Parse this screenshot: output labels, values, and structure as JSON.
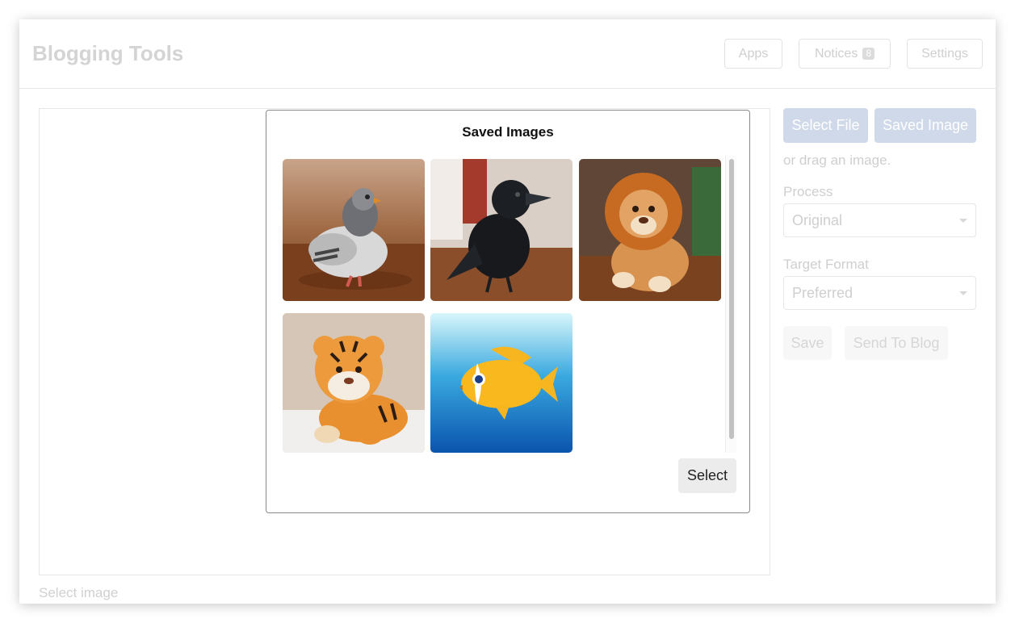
{
  "app": {
    "title": "Blogging Tools"
  },
  "nav": {
    "apps": "Apps",
    "notices": "Notices",
    "notices_count": "8",
    "settings": "Settings"
  },
  "canvas": {
    "caption": "Select image"
  },
  "sidebar": {
    "select_file": "Select File",
    "saved_image": "Saved Image",
    "drag_hint": "or drag an image.",
    "process_label": "Process",
    "process_value": "Original",
    "target_format_label": "Target Format",
    "target_format_value": "Preferred",
    "save": "Save",
    "send_to_blog": "Send To Blog"
  },
  "modal": {
    "title": "Saved Images",
    "select_button": "Select",
    "images": [
      {
        "subject": "plush pigeon"
      },
      {
        "subject": "plush crow"
      },
      {
        "subject": "plush lion"
      },
      {
        "subject": "plush tiger"
      },
      {
        "subject": "cartoon fish"
      }
    ]
  },
  "colors": {
    "primary_disabled": "#cfd9ea",
    "modal_border": "#8a8a8a",
    "select_button_bg": "#ececec"
  }
}
